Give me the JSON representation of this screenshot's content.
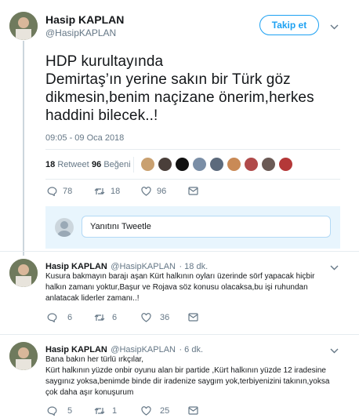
{
  "header": {
    "name": "Hasip KAPLAN",
    "handle": "@HasipKAPLAN",
    "follow_label": "Takip et"
  },
  "tweet": {
    "lines": [
      "HDP kurultayında",
      "Demirtaş’ın yerine sakın  bir Türk göz",
      "dikmesin,benim naçizane önerim,herkes",
      "haddini bilecek..!"
    ],
    "timestamp": "09:05 - 09 Oca 2018",
    "retweets_count": "18",
    "retweets_label": "Retweet",
    "likes_count": "96",
    "likes_label": "Beğeni",
    "likers": [
      "#c9a070",
      "#4a3f3a",
      "#111111",
      "#7a8ea6",
      "#5c6a7c",
      "#c98a56",
      "#b04a4a",
      "#6b5a55",
      "#b43838"
    ],
    "actions": {
      "replies": "78",
      "retweets": "18",
      "likes": "96"
    }
  },
  "reply_box": {
    "placeholder": "Yanıtını Tweetle"
  },
  "replies": [
    {
      "name": "Hasip KAPLAN",
      "handle": "@HasipKAPLAN",
      "time": "· 18 dk.",
      "text": [
        "Kusura bakmayın barajı aşan Kürt halkının oyları üzerinde sörf yapacak hiçbir",
        "halkın zamanı yoktur,Başur ve Rojava söz konusu olacaksa,bu işi ruhundan",
        "anlatacak liderler zamanı..!"
      ],
      "actions": {
        "replies": "6",
        "retweets": "6",
        "likes": "36"
      }
    },
    {
      "name": "Hasip KAPLAN",
      "handle": "@HasipKAPLAN",
      "time": "· 6 dk.",
      "text": [
        "Bana bakın her türlü ırkçılar,",
        "Kürt halkının yüzde onbir oyunu alan bir partide ,Kürt halkının yüzde 12 iradesine",
        "saygınız yoksa,benimde binde dir iradenize saygım yok,terbiyenizini takının,yoksa",
        "çok daha aşır konuşurum"
      ],
      "actions": {
        "replies": "5",
        "retweets": "1",
        "likes": "25"
      }
    }
  ]
}
